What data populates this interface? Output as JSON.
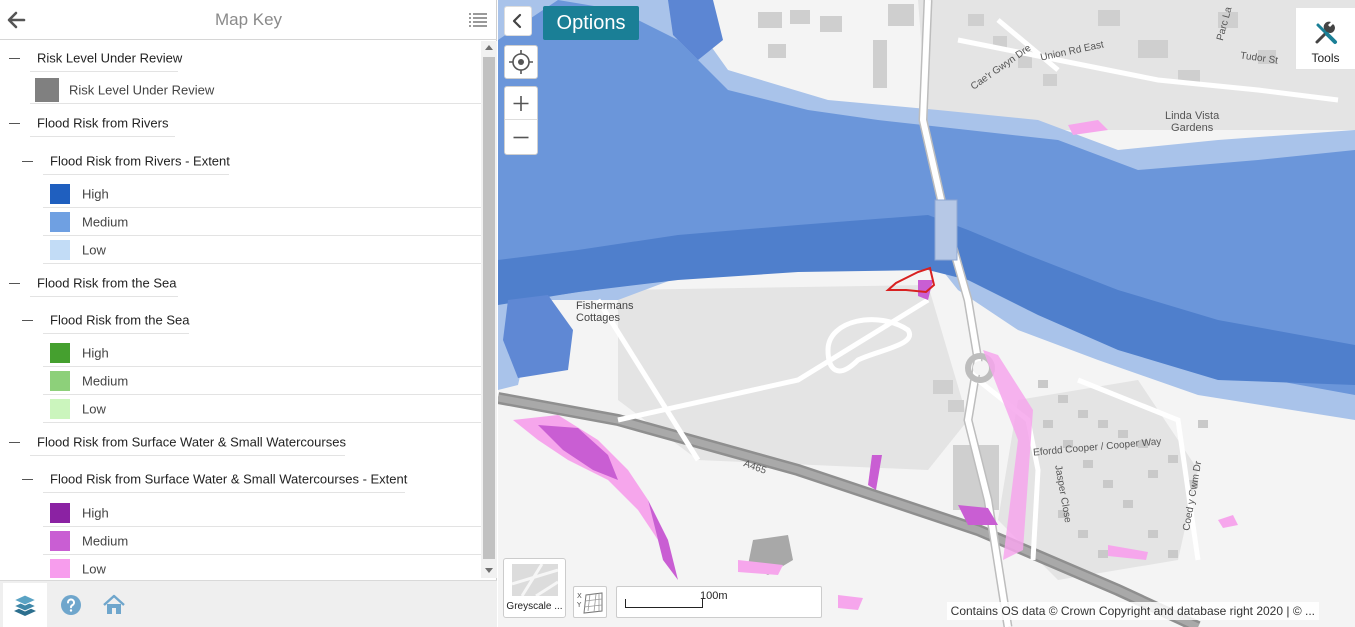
{
  "panel": {
    "title": "Map Key"
  },
  "legend": {
    "groups": [
      {
        "title": "Risk Level Under Review",
        "items": [
          {
            "label": "Risk Level Under Review",
            "color": "#808080"
          }
        ]
      },
      {
        "title": "Flood Risk from Rivers",
        "subtitle": "Flood Risk from Rivers - Extent",
        "items": [
          {
            "label": "High",
            "color": "#1f5fbf"
          },
          {
            "label": "Medium",
            "color": "#6fa0e2"
          },
          {
            "label": "Low",
            "color": "#c2dcf6"
          }
        ]
      },
      {
        "title": "Flood Risk from the Sea",
        "subtitle": "Flood Risk from the Sea",
        "items": [
          {
            "label": "High",
            "color": "#45a02f"
          },
          {
            "label": "Medium",
            "color": "#8dd07a"
          },
          {
            "label": "Low",
            "color": "#cbf5bd"
          }
        ]
      },
      {
        "title": "Flood Risk from Surface Water & Small Watercourses",
        "subtitle": "Flood Risk from Surface Water & Small Watercourses - Extent",
        "items": [
          {
            "label": "High",
            "color": "#8b22a3"
          },
          {
            "label": "Medium",
            "color": "#c95ed3"
          },
          {
            "label": "Low",
            "color": "#f79ded"
          }
        ]
      }
    ]
  },
  "footer": {
    "icons": [
      "layers-icon",
      "help-icon",
      "home-icon"
    ]
  },
  "map": {
    "options_label": "Options",
    "tools_label": "Tools",
    "basemap_label": "Greyscale ...",
    "scale_label": "100m",
    "attribution": "Contains OS data © Crown Copyright and database right 2020 | © ...",
    "place_labels": {
      "linda_vista": "Linda Vista\nGardens",
      "fishermans": "Fishermans\nCottages",
      "union_rd": "Union Rd East",
      "tudor": "Tudor St",
      "caer": "Cae'r Gwyn Dre",
      "parc": "Parc La",
      "efordd": "Efordd Cooper / Cooper Way",
      "a465": "A465",
      "jasper": "Jasper Close",
      "coedy": "Coed y Cwm Dr"
    },
    "colors": {
      "rivers_high": "#4a7fd0",
      "rivers_medium": "#6893d8",
      "rivers_low": "#9dbbe8",
      "surface_medium": "#c95ed3",
      "surface_low": "#f79ded",
      "site_outline": "#d82020",
      "options_bg": "#1a7f96"
    }
  }
}
